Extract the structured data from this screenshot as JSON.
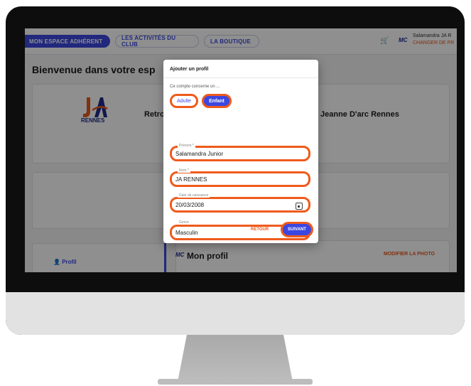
{
  "nav": {
    "tab_active": "MON ESPACE ADHÉRENT",
    "tab_activities": "LES ACTIVITÉS DU CLUB",
    "tab_shop": "LA BOUTIQUE"
  },
  "header": {
    "logo": "MC",
    "user_name": "Salamandra JA R",
    "change_profile": "CHANGER DE PR"
  },
  "page": {
    "welcome": "Bienvenue dans votre esp",
    "club_logo_text": "RENNES",
    "retro_text": "Retro",
    "club_name": "Jeanne D'arc Rennes",
    "side_profile": "Profil",
    "profile_logo": "MC",
    "profile_title": "Mon profil",
    "modify_photo": "MODIFIER LA PHOTO"
  },
  "modal": {
    "title": "Ajouter un profil",
    "concerne": "Ce compte concerne un ...",
    "adulte": "Adulte",
    "enfant": "Enfant",
    "fields": [
      {
        "label": "Prénom *",
        "value": "Salamandra Junior"
      },
      {
        "label": "Nom *",
        "value": "JA RENNES"
      },
      {
        "label": "Date de naissance",
        "value": "20/03/2008"
      },
      {
        "label": "Genre",
        "value": "Masculin"
      }
    ],
    "retour": "RETOUR",
    "suivant": "SUIVANT"
  },
  "colors": {
    "accent": "#3b47e0",
    "highlight": "#ef5a1c",
    "brand_orange": "#e8581a"
  }
}
